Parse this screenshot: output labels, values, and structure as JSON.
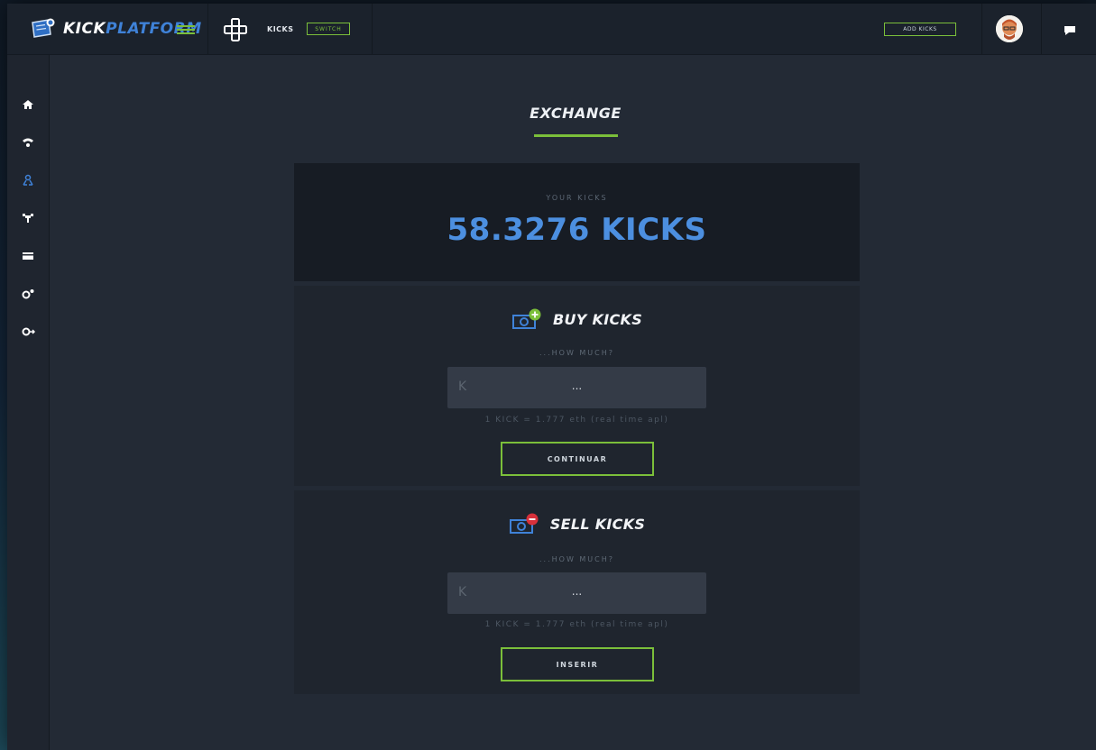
{
  "app": {
    "brand_part1": "KICK",
    "brand_part2": "PLATFORM",
    "accent_color": "#7bbf3a",
    "brand_blue": "#3f82d8"
  },
  "topbar": {
    "kicks_tab_label": "KICKS",
    "switch_label": "SWITCH",
    "add_kicks_label": "ADD KICKS",
    "icons": [
      "logo-icon",
      "menu-icon",
      "gamepad-icon",
      "avatar",
      "chat-icon"
    ]
  },
  "sidebar": {
    "items": [
      {
        "icon": "home-icon"
      },
      {
        "icon": "wifi-icon"
      },
      {
        "icon": "exchange-icon",
        "active": true
      },
      {
        "icon": "tournament-icon"
      },
      {
        "icon": "wallet-icon"
      },
      {
        "icon": "settings-icon"
      },
      {
        "icon": "logout-icon"
      }
    ]
  },
  "main": {
    "title": "EXCHANGE",
    "balance": {
      "label": "YOUR KICKS",
      "value": "58.3276 KICKS"
    },
    "buy": {
      "title": "BUY KICKS",
      "question": "...HOW MUCH?",
      "input_prefix": "K",
      "input_value": "...",
      "rate_note": "1 KICK = 1.777 eth (real time apl)",
      "button_label": "CONTINUAR"
    },
    "sell": {
      "title": "SELL KICKS",
      "question": "...HOW MUCH?",
      "input_prefix": "K",
      "input_value": "...",
      "rate_note": "1 KICK = 1.777 eth (real time apl)",
      "button_label": "INSERIR"
    }
  }
}
